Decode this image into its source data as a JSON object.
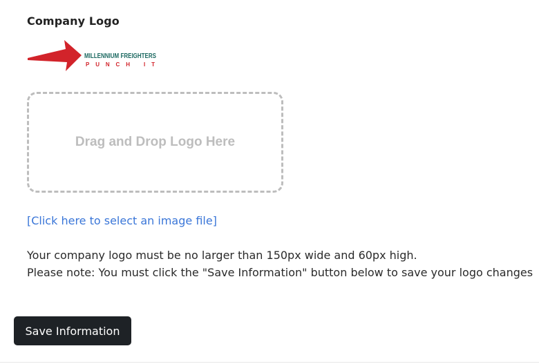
{
  "section": {
    "title": "Company Logo"
  },
  "logo": {
    "line1": "MILLENNIUM FREIGHTERS",
    "line2": "PUNCH IT",
    "arrow_color": "#d2232a",
    "line1_color": "#1f6b63",
    "line2_color": "#d2232a"
  },
  "dropzone": {
    "text": "Drag and Drop Logo Here"
  },
  "select_link": {
    "text": "[Click here to select an image file]"
  },
  "notes": {
    "size_limit": "Your company logo must be no larger than 150px wide and 60px high.",
    "save_reminder": "Please note: You must click the \"Save Information\" button below to save your logo changes"
  },
  "save_button": {
    "label": "Save Information"
  }
}
